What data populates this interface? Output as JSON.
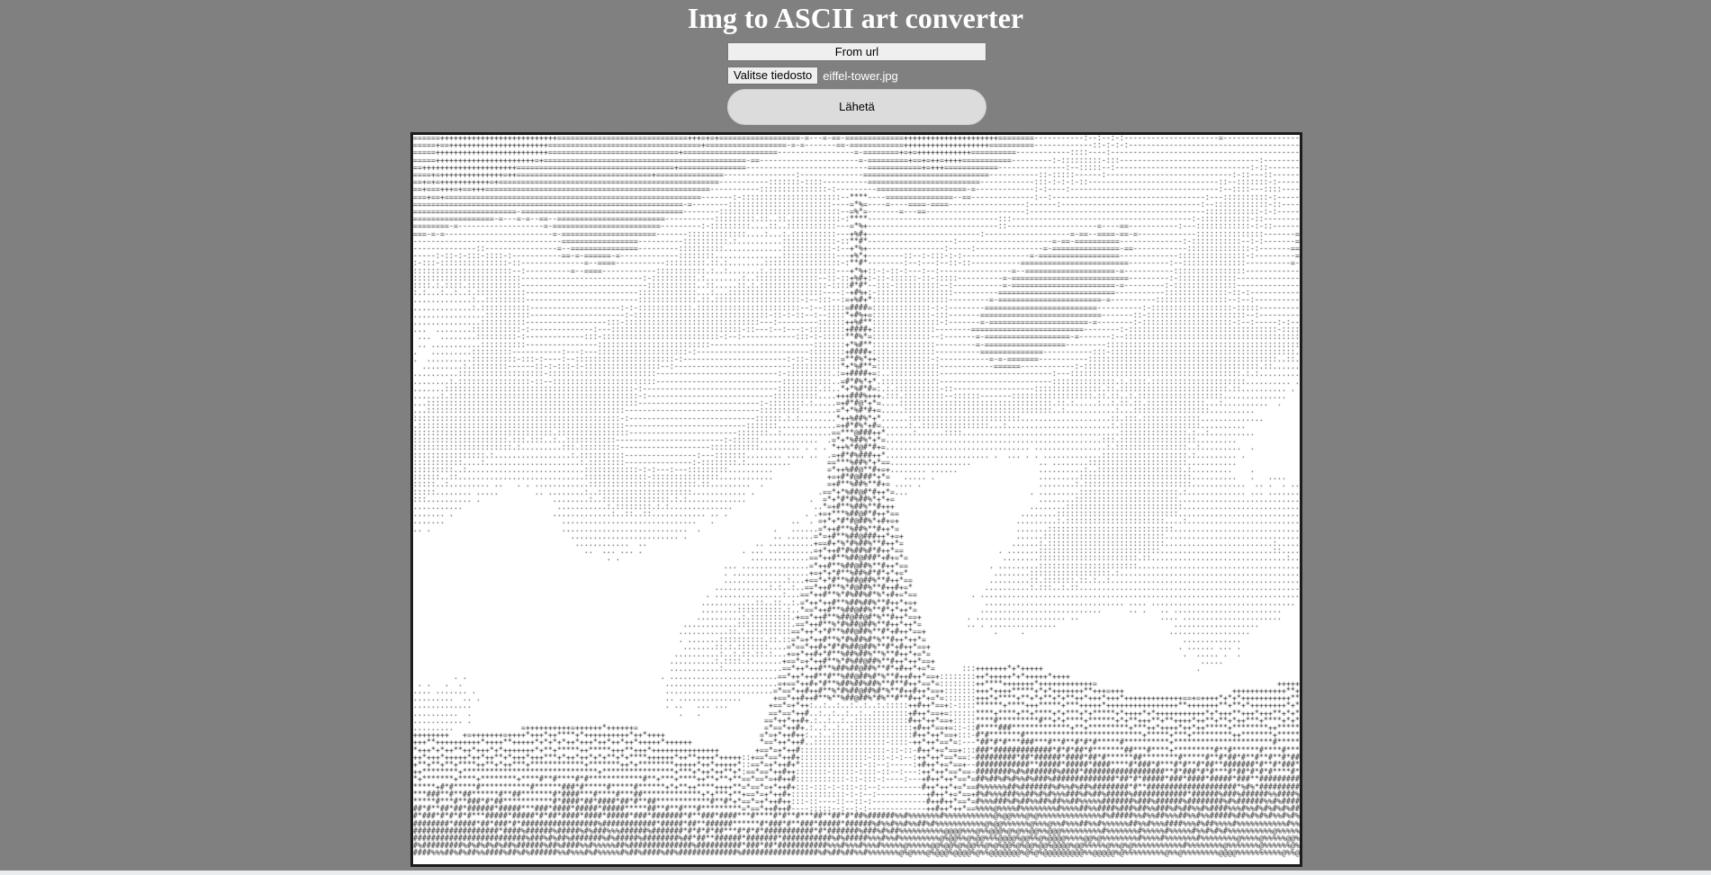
{
  "page": {
    "title": "Img to ASCII art converter"
  },
  "form": {
    "from_url_label": "From url",
    "choose_file_label": "Valitse tiedosto",
    "selected_file": "eiffel-tower.jpg",
    "submit_label": "Lähetä"
  },
  "ascii_art": {
    "charset": " .:-=+*#%@",
    "subject": "eiffel-tower"
  },
  "colors": {
    "page_background": "#808080",
    "art_background": "#ffffff",
    "art_text": "#111111",
    "title_text": "#ffffff"
  }
}
